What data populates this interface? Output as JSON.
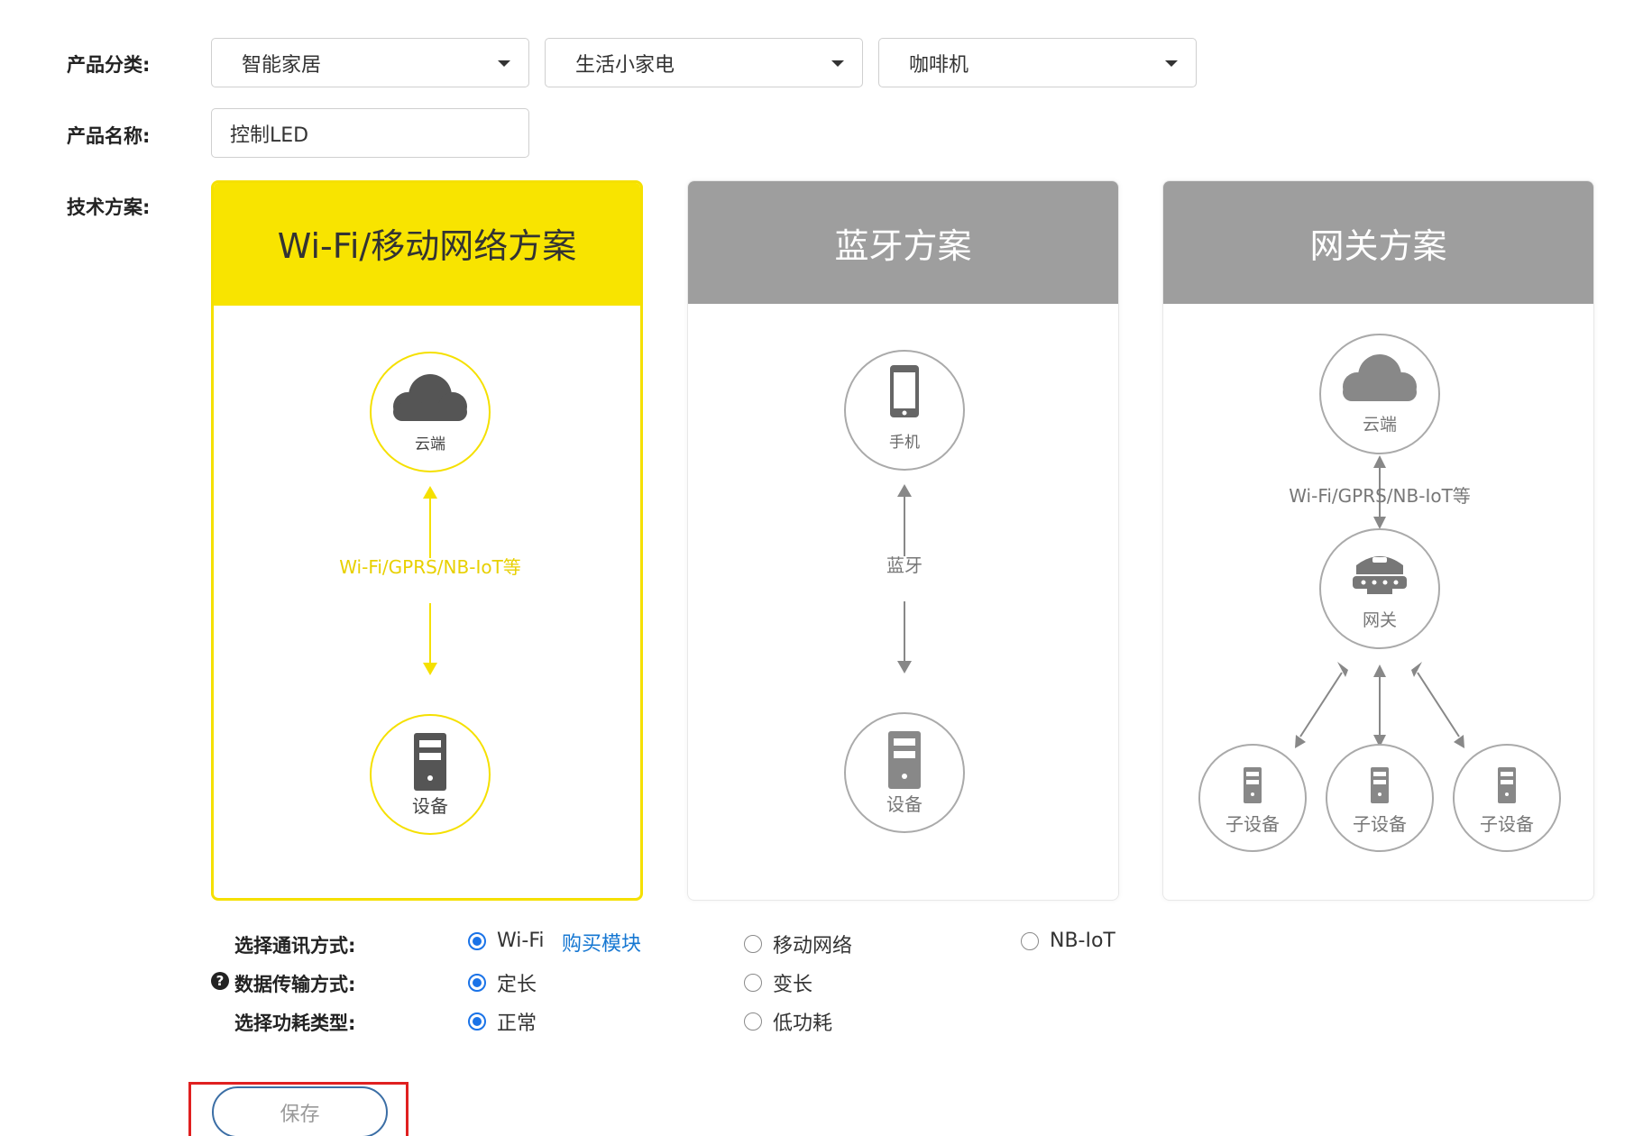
{
  "form": {
    "category_label": "产品分类:",
    "name_label": "产品名称:",
    "tech_label": "技术方案:",
    "category_selects": [
      {
        "value": "智能家居"
      },
      {
        "value": "生活小家电"
      },
      {
        "value": "咖啡机"
      }
    ],
    "product_name": "控制LED"
  },
  "solutions": {
    "wifi": {
      "title": "Wi-Fi/移动网络方案",
      "cloud_label": "云端",
      "link_label": "Wi-Fi/GPRS/NB-IoT等",
      "device_label": "设备"
    },
    "bluetooth": {
      "title": "蓝牙方案",
      "phone_label": "手机",
      "link_label": "蓝牙",
      "device_label": "设备"
    },
    "gateway": {
      "title": "网关方案",
      "cloud_label": "云端",
      "link_label": "Wi-Fi/GPRS/NB-IoT等",
      "gateway_label": "网关",
      "subdevice_labels": [
        "子设备",
        "子设备",
        "子设备"
      ]
    }
  },
  "options": {
    "comm_label": "选择通讯方式:",
    "comm_options": [
      "Wi-Fi",
      "移动网络",
      "NB-IoT"
    ],
    "buy_link": "购买模块",
    "transfer_label": "数据传输方式:",
    "transfer_help_icon": "?",
    "transfer_options": [
      "定长",
      "变长"
    ],
    "power_label": "选择功耗类型:",
    "power_options": [
      "正常",
      "低功耗"
    ]
  },
  "actions": {
    "save_label": "保存"
  },
  "colors": {
    "active_yellow": "#f8e400",
    "inactive_gray": "#9e9e9e",
    "link_blue": "#1677d2",
    "radio_blue": "#1a73e8",
    "highlight_red": "#e02020"
  }
}
